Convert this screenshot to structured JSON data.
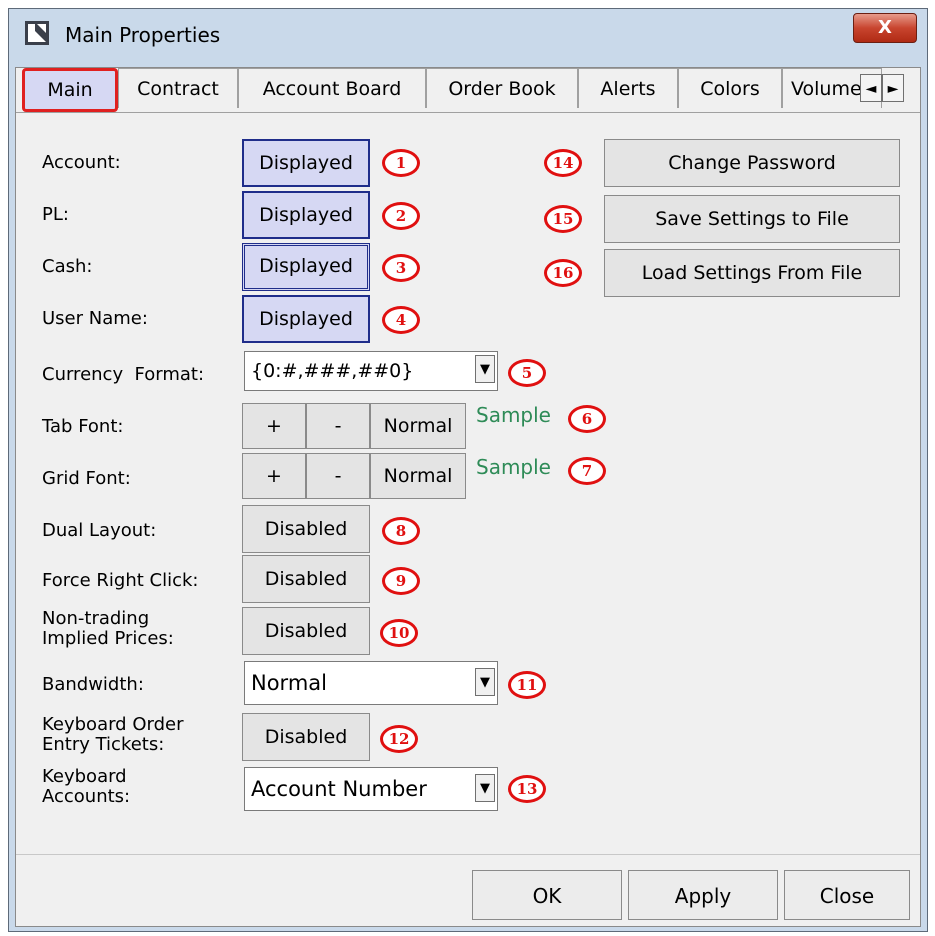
{
  "window": {
    "title": "Main Properties",
    "close_glyph": "X"
  },
  "tabs": [
    {
      "label": "Main"
    },
    {
      "label": "Contract"
    },
    {
      "label": "Account Board"
    },
    {
      "label": "Order Book"
    },
    {
      "label": "Alerts"
    },
    {
      "label": "Colors"
    },
    {
      "label": "Volume"
    }
  ],
  "tab_scroll": {
    "left": "◄",
    "right": "►"
  },
  "fields": {
    "account": {
      "label": "Account:",
      "value": "Displayed",
      "badge": "1"
    },
    "pl": {
      "label": "PL:",
      "value": "Displayed",
      "badge": "2"
    },
    "cash": {
      "label": "Cash:",
      "value": "Displayed",
      "badge": "3"
    },
    "user_name": {
      "label": "User Name:",
      "value": "Displayed",
      "badge": "4"
    },
    "currency_format": {
      "label": "Currency  Format:",
      "value": "{0:#,###,##0}",
      "badge": "5"
    },
    "tab_font": {
      "label": "Tab Font:",
      "plus": "+",
      "minus": "-",
      "normal": "Normal",
      "sample": "Sample",
      "badge": "6"
    },
    "grid_font": {
      "label": "Grid Font:",
      "plus": "+",
      "minus": "-",
      "normal": "Normal",
      "sample": "Sample",
      "badge": "7"
    },
    "dual_layout": {
      "label": "Dual Layout:",
      "value": "Disabled",
      "badge": "8"
    },
    "force_right_click": {
      "label": "Force Right Click:",
      "value": "Disabled",
      "badge": "9"
    },
    "non_trading": {
      "label_line1": "Non-trading",
      "label_line2": "Implied Prices:",
      "value": "Disabled",
      "badge": "10"
    },
    "bandwidth": {
      "label": "Bandwidth:",
      "value": "Normal",
      "badge": "11"
    },
    "keyboard_order": {
      "label_line1": "Keyboard Order",
      "label_line2": "Entry Tickets:",
      "value": "Disabled",
      "badge": "12"
    },
    "keyboard_accounts": {
      "label_line1": "Keyboard",
      "label_line2": "Accounts:",
      "value": "Account Number",
      "badge": "13"
    }
  },
  "actions": {
    "change_password": {
      "label": "Change Password",
      "badge": "14"
    },
    "save_settings": {
      "label": "Save Settings to File",
      "badge": "15"
    },
    "load_settings": {
      "label": "Load Settings From File",
      "badge": "16"
    }
  },
  "footer": {
    "ok": "OK",
    "apply": "Apply",
    "close": "Close"
  },
  "colors": {
    "accent_red": "#e01010",
    "displayed_bg": "#d6d8f3",
    "sample_green": "#2e8b57"
  }
}
